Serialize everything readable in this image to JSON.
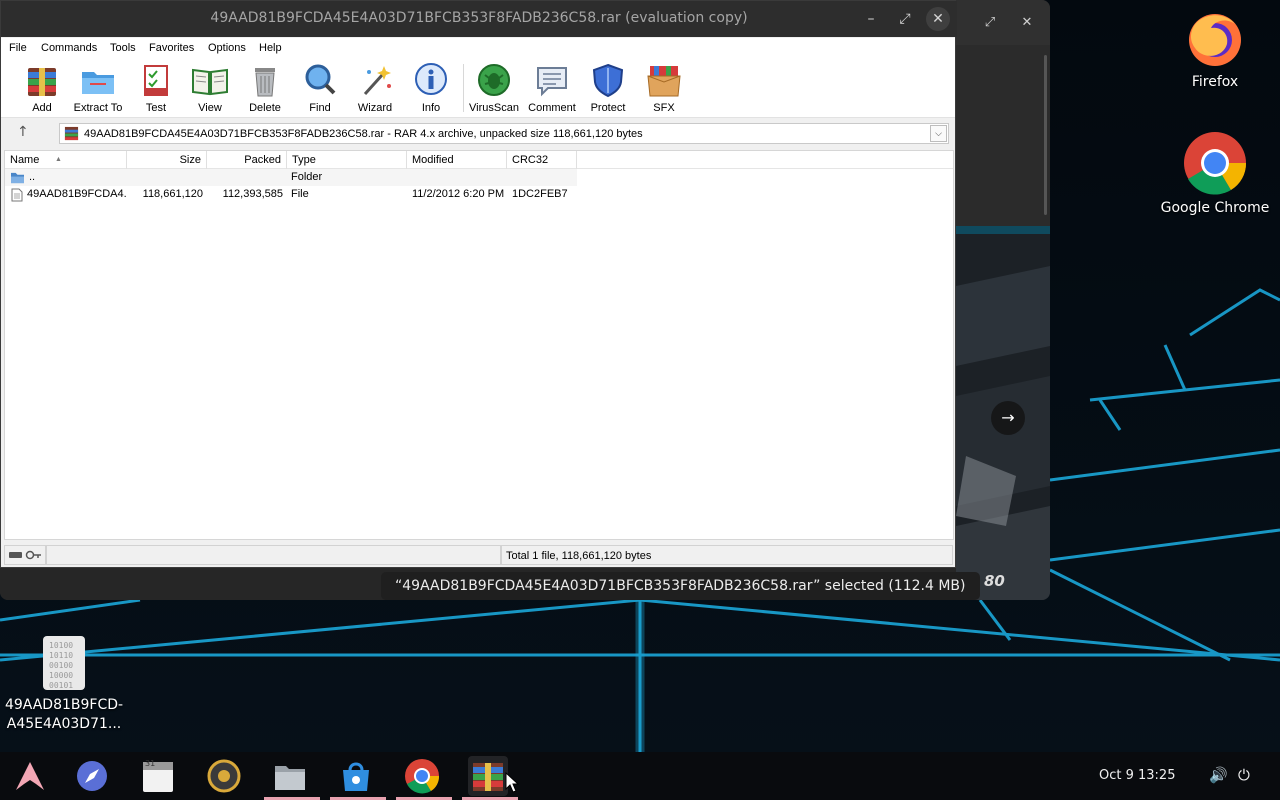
{
  "window": {
    "title": "49AAD81B9FCDA45E4A03D71BFCB353F8FADB236C58.rar (evaluation copy)",
    "minimize": "–",
    "maximize": "⤢",
    "close": "✕"
  },
  "menu": [
    "File",
    "Commands",
    "Tools",
    "Favorites",
    "Options",
    "Help"
  ],
  "toolbar": {
    "add": "Add",
    "extract": "Extract To",
    "test": "Test",
    "view": "View",
    "delete": "Delete",
    "find": "Find",
    "wizard": "Wizard",
    "info": "Info",
    "virusscan": "VirusScan",
    "comment": "Comment",
    "protect": "Protect",
    "sfx": "SFX"
  },
  "address": {
    "up": "↑",
    "path": "49AAD81B9FCDA45E4A03D71BFCB353F8FADB236C58.rar - RAR 4.x archive, unpacked size 118,661,120 bytes",
    "dropdown": "⌵"
  },
  "columns": [
    "Name",
    "Size",
    "Packed",
    "Type",
    "Modified",
    "CRC32"
  ],
  "sort_arrow": "▲",
  "files": [
    {
      "name": "..",
      "size": "",
      "packed": "",
      "type": "Folder",
      "modified": "",
      "crc": ""
    },
    {
      "name": "49AAD81B9FCDA4...",
      "size": "118,661,120",
      "packed": "112,393,585",
      "type": "File",
      "modified": "11/2/2012 6:20 PM",
      "crc": "1DC2FEB7"
    }
  ],
  "status": {
    "total": "Total 1 file, 118,661,120 bytes"
  },
  "background_window": {
    "maximize": "⤢",
    "close": "✕",
    "next": "→",
    "preview_text": "80"
  },
  "toast": "“49AAD81B9FCDA45E4A03D71BFCB353F8FADB236C58.rar” selected  (112.4 MB)",
  "desktop": {
    "firefox": "Firefox",
    "chrome": "Google Chrome",
    "file_line1": "49AAD81B9FCD-",
    "file_line2": "A45E4A03D71..."
  },
  "taskbar": {
    "clock": "Oct 9  13:25",
    "volume": "🔊",
    "power": "⏻",
    "calendar_day": "31"
  },
  "colors": {
    "title_bg": "#2d2d2d",
    "wallpaper_glow": "#1ba6d8",
    "taskbar_indicator": "#e8a2b0"
  }
}
